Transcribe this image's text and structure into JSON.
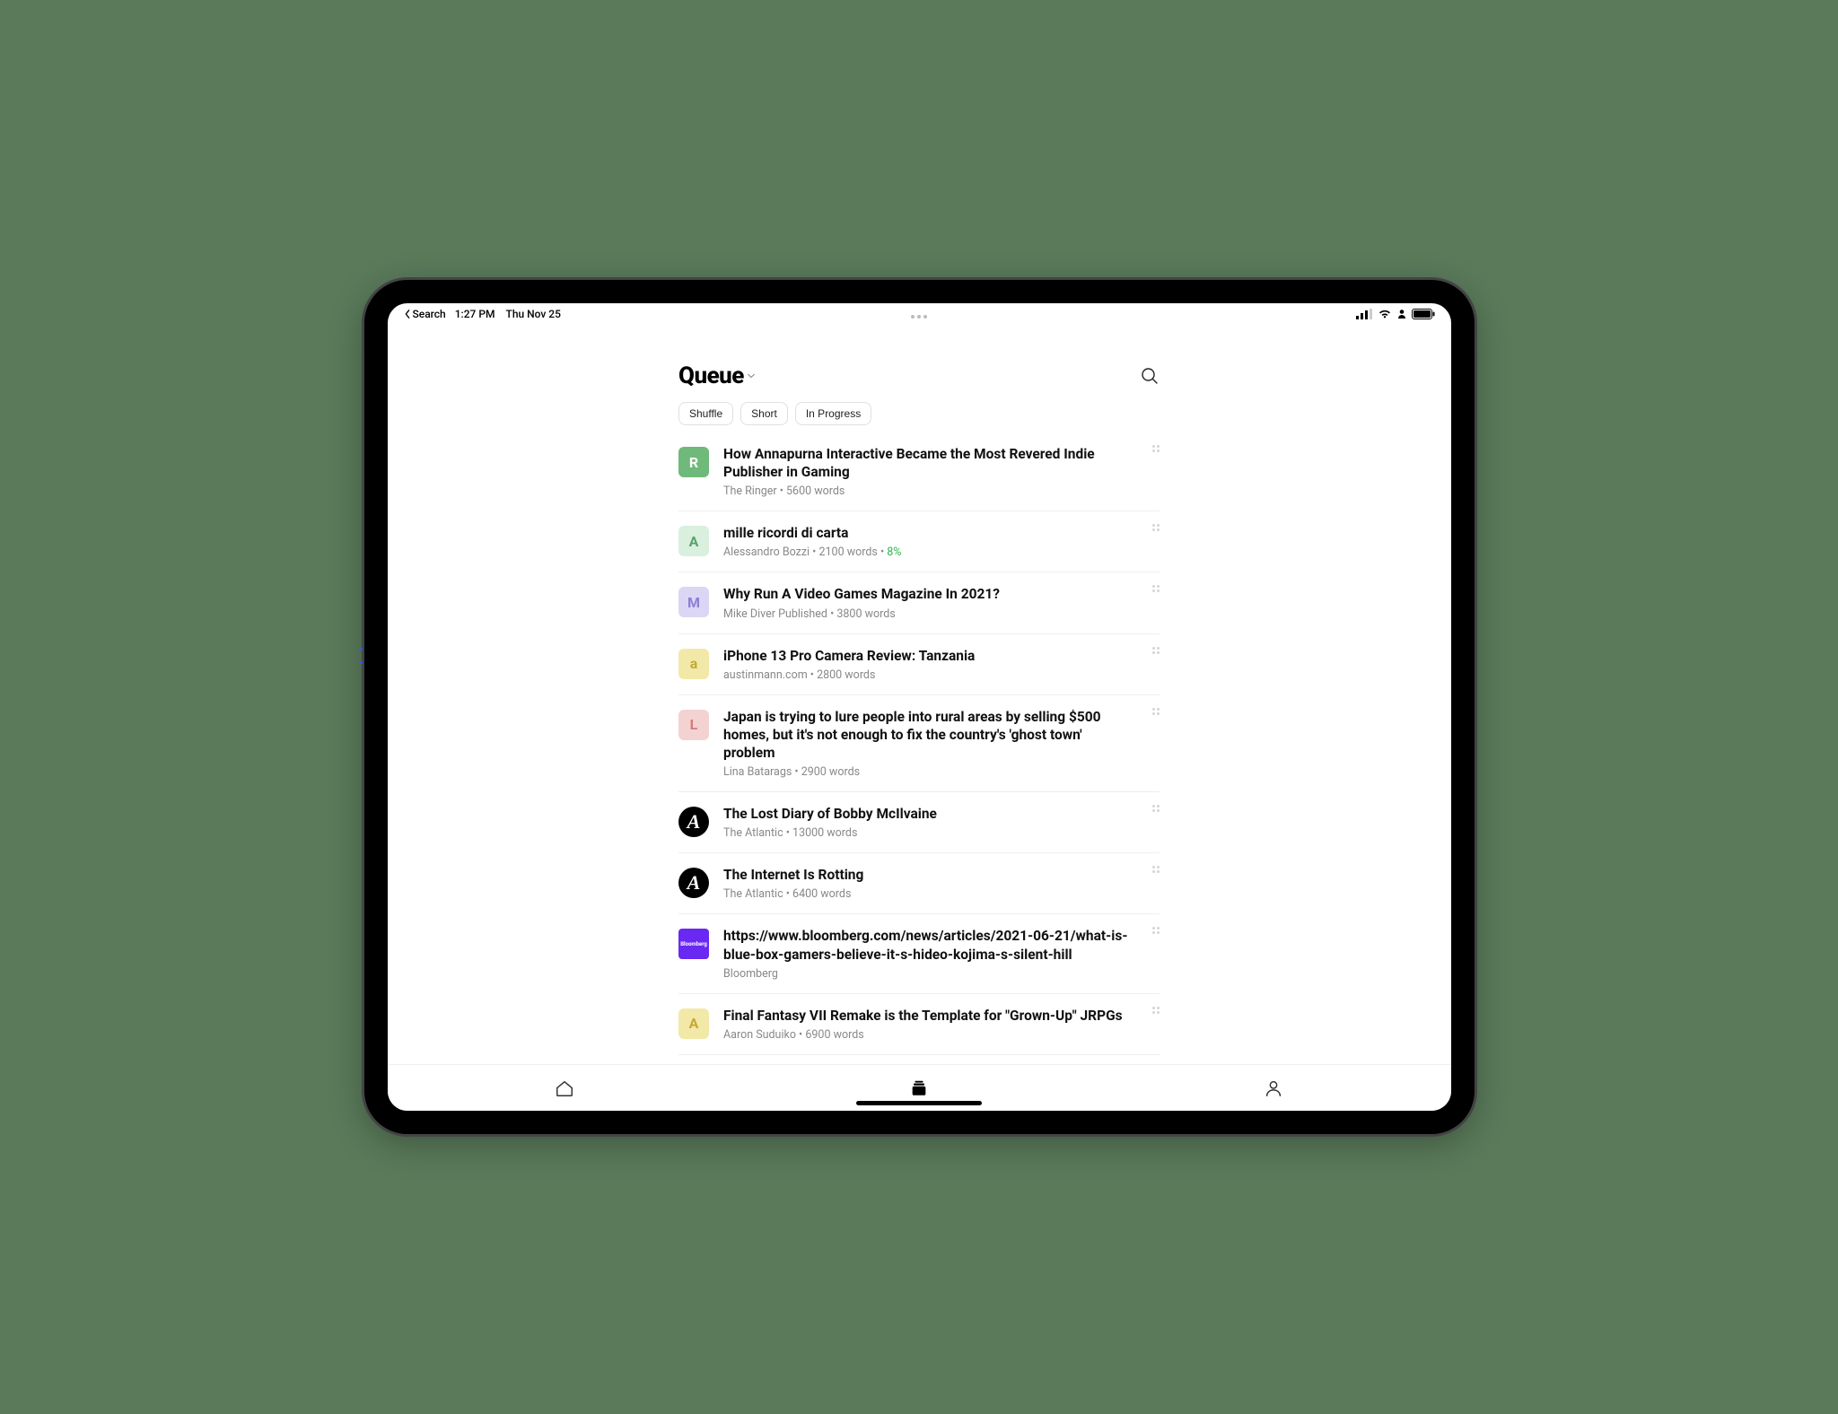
{
  "status_bar": {
    "back_label": "Search",
    "time": "1:27 PM",
    "date": "Thu Nov 25"
  },
  "header": {
    "title": "Queue"
  },
  "filters": {
    "pills": [
      "Shuffle",
      "Short",
      "In Progress"
    ]
  },
  "articles": [
    {
      "title": "How Annapurna Interactive Became the Most Revered Indie Publisher in Gaming",
      "source": "The Ringer",
      "words": "5600 words",
      "progress": "",
      "thumb_letter": "R",
      "thumb_bg": "#6fb97a",
      "thumb_color": "#ffffff",
      "thumb_type": "letter"
    },
    {
      "title": "mille ricordi di carta",
      "source": "Alessandro Bozzi",
      "words": "2100 words",
      "progress": "8%",
      "thumb_letter": "A",
      "thumb_bg": "#d9f0de",
      "thumb_color": "#5aa06c",
      "thumb_type": "letter"
    },
    {
      "title": "Why Run A Video Games Magazine In 2021?",
      "source": "Mike Diver Published",
      "words": "3800 words",
      "progress": "",
      "thumb_letter": "M",
      "thumb_bg": "#dcd6f5",
      "thumb_color": "#8b7fd6",
      "thumb_type": "letter"
    },
    {
      "title": "iPhone 13 Pro Camera Review: Tanzania",
      "source": "austinmann.com",
      "words": "2800 words",
      "progress": "",
      "thumb_letter": "a",
      "thumb_bg": "#f2e9a8",
      "thumb_color": "#c4a837",
      "thumb_type": "letter"
    },
    {
      "title": "Japan is trying to lure people into rural areas by selling $500 homes, but it's not enough to fix the country's 'ghost town' problem",
      "source": "Lina Batarags",
      "words": "2900 words",
      "progress": "",
      "thumb_letter": "L",
      "thumb_bg": "#f5d2d2",
      "thumb_color": "#d47a7a",
      "thumb_type": "letter"
    },
    {
      "title": "The Lost Diary of Bobby McIlvaine",
      "source": "The Atlantic",
      "words": "13000 words",
      "progress": "",
      "thumb_letter": "A",
      "thumb_bg": "#000000",
      "thumb_color": "#ffffff",
      "thumb_type": "atlantic"
    },
    {
      "title": "The Internet Is Rotting",
      "source": "The Atlantic",
      "words": "6400 words",
      "progress": "",
      "thumb_letter": "A",
      "thumb_bg": "#000000",
      "thumb_color": "#ffffff",
      "thumb_type": "atlantic"
    },
    {
      "title": "https://www.bloomberg.com/news/articles/2021-06-21/what-is-blue-box-gamers-believe-it-s-hideo-kojima-s-silent-hill",
      "source": "Bloomberg",
      "words": "",
      "progress": "",
      "thumb_letter": "Bloomberg",
      "thumb_bg": "#6929f2",
      "thumb_color": "#ffffff",
      "thumb_type": "bloomberg"
    },
    {
      "title": "Final Fantasy VII Remake is the Template for \"Grown-Up\" JRPGs",
      "source": "Aaron Suduiko",
      "words": "6900 words",
      "progress": "",
      "thumb_letter": "A",
      "thumb_bg": "#f2e9a8",
      "thumb_color": "#c4a837",
      "thumb_type": "letter"
    }
  ]
}
